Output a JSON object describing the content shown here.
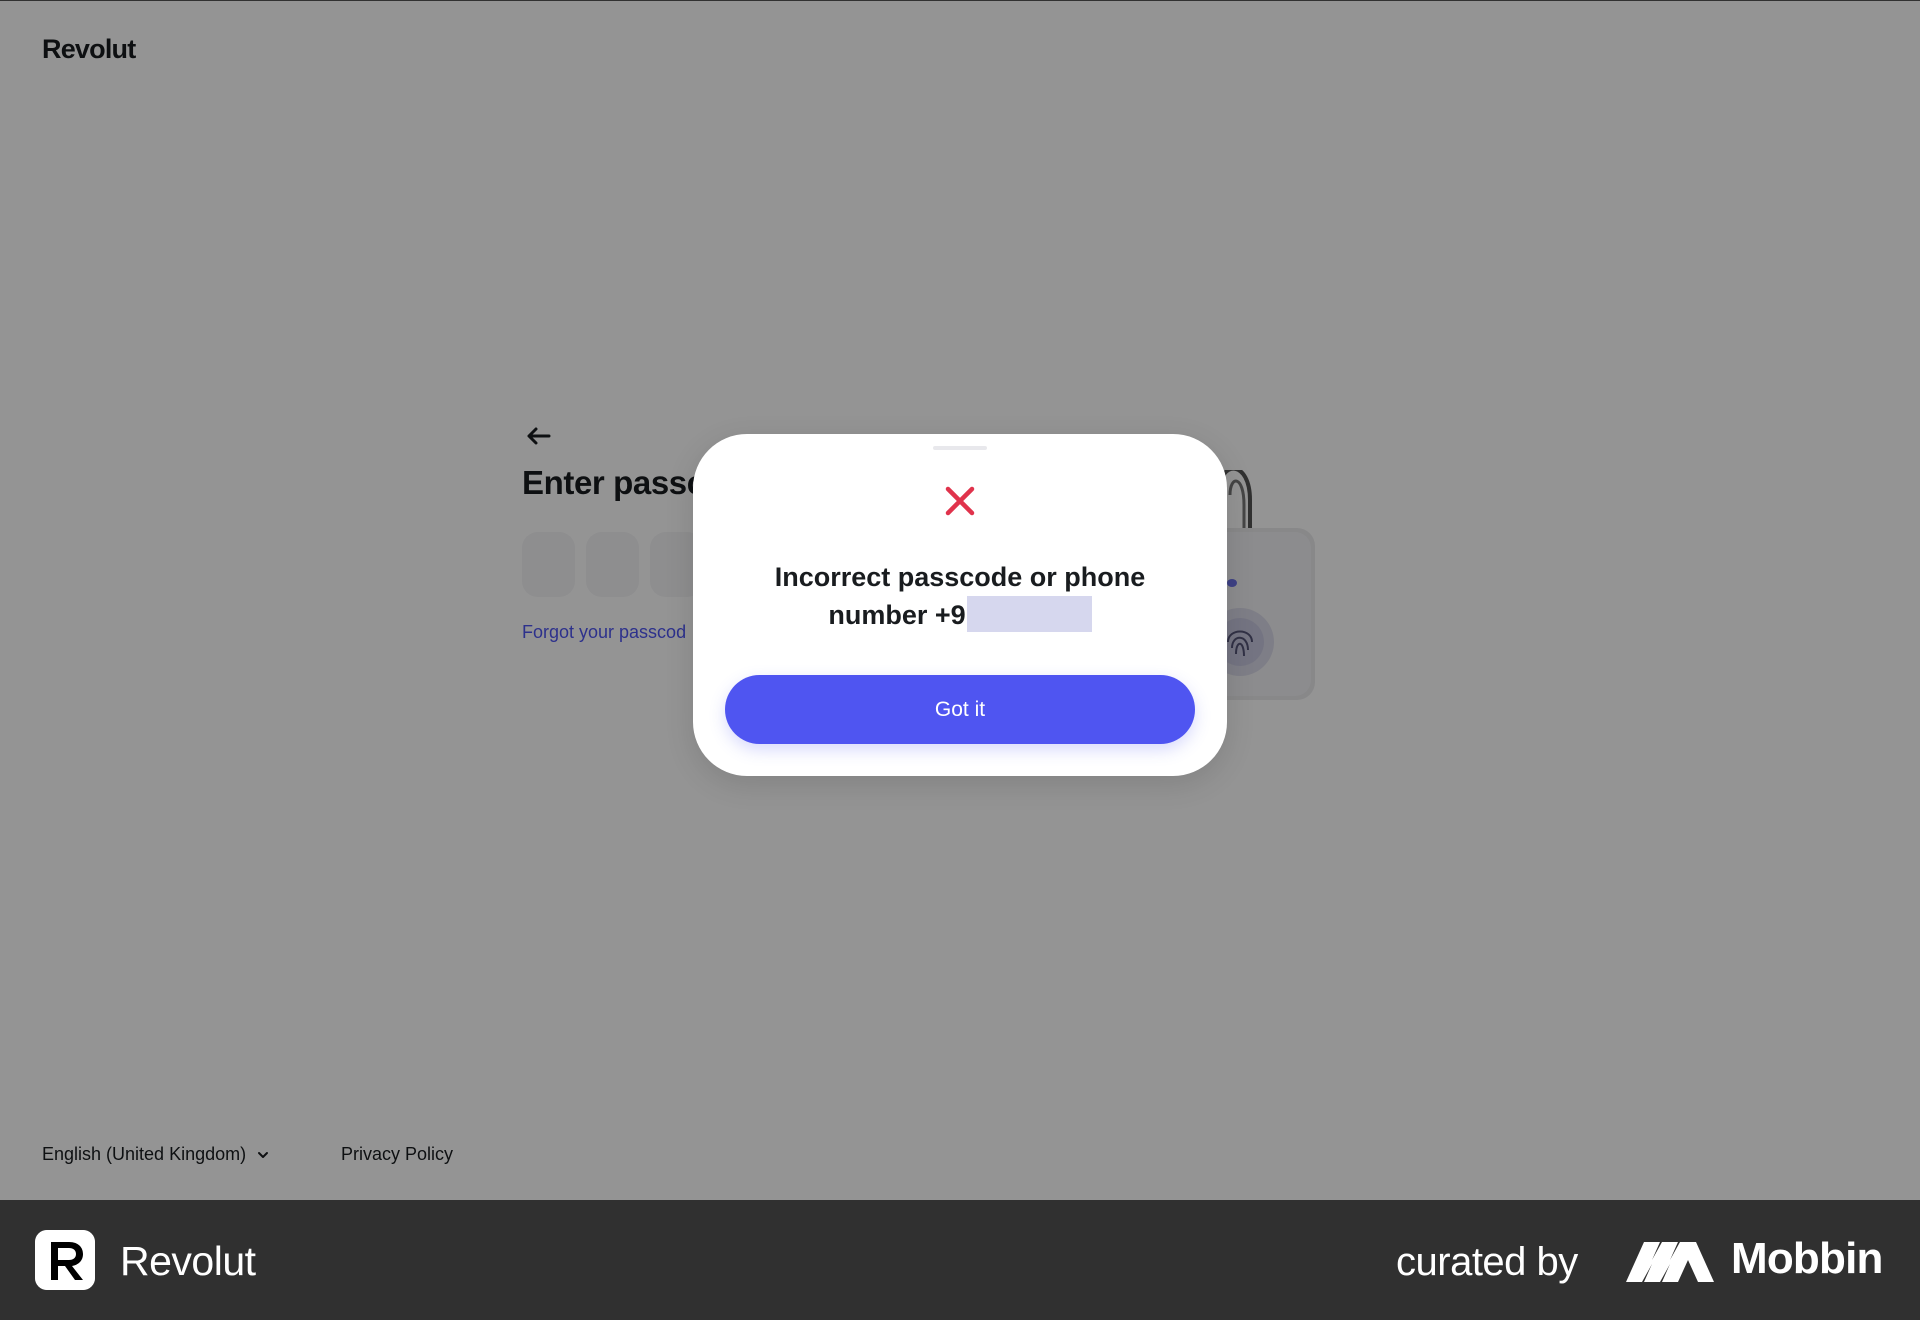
{
  "header": {
    "logo_text": "Revolut"
  },
  "login": {
    "heading": "Enter passc",
    "pin_boxes": 3,
    "forgot_link": "Forgot your passcod"
  },
  "footer": {
    "language": "English (United Kingdom)",
    "privacy": "Privacy Policy"
  },
  "modal": {
    "message_line1": "Incorrect passcode or phone",
    "message_line2_prefix": "number +9",
    "button_label": "Got it",
    "error_color": "#e0334c",
    "accent_color": "#4f55f1"
  },
  "bottom_bar": {
    "app_name": "Revolut",
    "curated_by": "curated by",
    "brand": "Mobbin",
    "app_icon": "revolut-r-icon",
    "brand_icon": "mobbin-logo-icon"
  }
}
